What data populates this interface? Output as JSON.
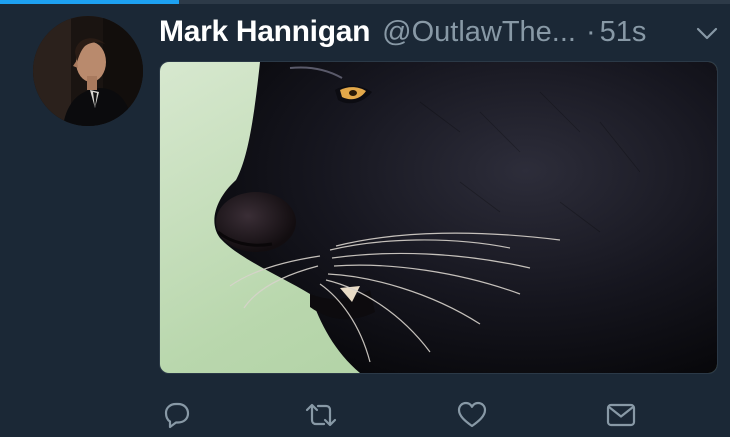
{
  "tweet": {
    "author": {
      "display_name": "Mark Hannigan",
      "handle": "@OutlawThe..."
    },
    "separator": "·",
    "timestamp": "51s",
    "media": {
      "alt_subject": "black panther close-up"
    },
    "actions": {
      "reply_icon": "reply-icon",
      "retweet_icon": "retweet-icon",
      "like_icon": "heart-icon",
      "message_icon": "envelope-icon"
    }
  },
  "loading_bar": {
    "progress": 0.245
  },
  "colors": {
    "background": "#1b2836",
    "name": "#ffffff",
    "secondary_text": "#8899a6",
    "accent": "#1da1f2"
  }
}
